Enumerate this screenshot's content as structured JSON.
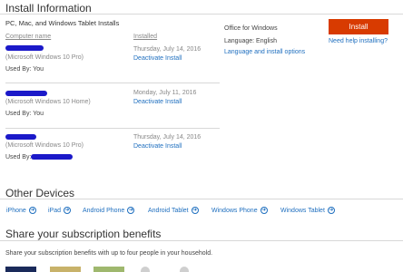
{
  "header": {
    "title": "Install Information"
  },
  "pc_section": {
    "title": "PC, Mac, and Windows Tablet Installs",
    "col_computer": "Computer name",
    "col_installed": "Installed",
    "installs": [
      {
        "os": "(Microsoft Windows 10 Pro)",
        "used_by": "Used By: You",
        "date": "Thursday, July 14, 2016",
        "action": "Deactivate Install"
      },
      {
        "os": "(Microsoft Windows 10 Home)",
        "used_by": "Used By: You",
        "date": "Monday, July 11, 2016",
        "action": "Deactivate Install"
      },
      {
        "os": "(Microsoft Windows 10 Pro)",
        "used_by": "Used By:",
        "date": "Thursday, July 14, 2016",
        "action": "Deactivate Install"
      }
    ]
  },
  "office_panel": {
    "product": "Office for Windows",
    "language": "Language: English",
    "language_link": "Language and install options",
    "install_button": "Install",
    "help_link": "Need help installing?"
  },
  "other_devices": {
    "title": "Other Devices",
    "items": [
      "iPhone",
      "iPad",
      "Android Phone",
      "Android Tablet",
      "Windows Phone",
      "Windows Tablet"
    ]
  },
  "share": {
    "title": "Share your subscription benefits",
    "description": "Share your subscription benefits with up to four people in your household."
  },
  "colors": {
    "accent": "#1f6fbf",
    "install_button": "#d83b01",
    "redaction": "#1b19c9"
  }
}
